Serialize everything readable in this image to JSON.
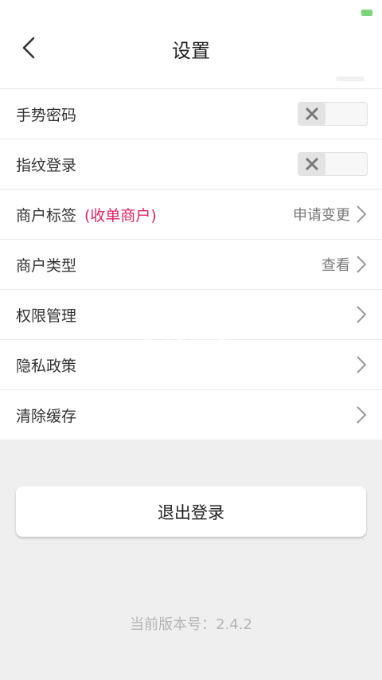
{
  "header": {
    "title": "设置"
  },
  "rows": [
    {
      "label": "手势密码",
      "type": "toggle",
      "on": false
    },
    {
      "label": "指纹登录",
      "type": "toggle",
      "on": false
    },
    {
      "label": "商户标签",
      "tag": "(收单商户)",
      "value": "申请变更",
      "type": "link"
    },
    {
      "label": "商户类型",
      "value": "查看",
      "type": "link"
    },
    {
      "label": "权限管理",
      "type": "link"
    },
    {
      "label": "隐私政策",
      "type": "link"
    },
    {
      "label": "清除缓存",
      "type": "link"
    }
  ],
  "logout_label": "退出登录",
  "version_label": "当前版本号：2.4.2",
  "watermark": {
    "text": "K73 游戏之家 .com"
  },
  "colors": {
    "tag": "#e0245e",
    "background": "#efefef",
    "status_battery": "#7bd67b"
  },
  "icons": {
    "back": "chevron-left-icon",
    "row_arrow": "chevron-right-icon",
    "toggle_off": "close-icon"
  }
}
